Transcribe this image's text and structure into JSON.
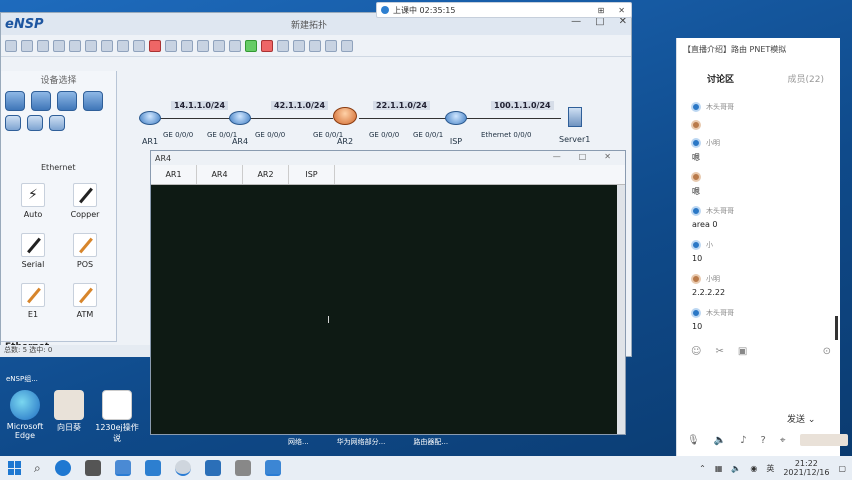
{
  "ensp": {
    "logo": "eNSP",
    "title": "新建拓扑",
    "controls": [
      "—",
      "□",
      "✕"
    ],
    "device_panel_title": "设备选择",
    "ethernet_label": "Ethernet",
    "cables": [
      {
        "label": "Auto",
        "style": "bolt"
      },
      {
        "label": "Copper",
        "style": "black"
      },
      {
        "label": "Serial",
        "style": "black"
      },
      {
        "label": "POS",
        "style": "orange"
      },
      {
        "label": "E1",
        "style": "orange"
      },
      {
        "label": "ATM",
        "style": "black"
      }
    ],
    "section_label": "Ethernet",
    "status": "总数: 5  选中: 0"
  },
  "topology": {
    "subnets": [
      "14.1.1.0/24",
      "42.1.1.0/24",
      "22.1.1.0/24",
      "100.1.1.0/24"
    ],
    "nodes": [
      "AR1",
      "AR4",
      "AR2",
      "ISP",
      "Server1"
    ],
    "ports": [
      "GE 0/0/0",
      "GE 0/0/1",
      "GE 0/0/0",
      "GE 0/0/1",
      "GE 0/0/0",
      "GE 0/0/1",
      "Ethernet 0/0/0"
    ]
  },
  "console": {
    "title": "AR4",
    "controls": [
      "—",
      "□",
      "✕"
    ],
    "tabs": [
      "AR1",
      "AR4",
      "AR2",
      "ISP"
    ]
  },
  "recording": {
    "text": "上课中 02:35:15",
    "controls": [
      "⊞",
      "✕"
    ]
  },
  "chat": {
    "header": "【直播介绍】路由  PNET模拟",
    "tabs": {
      "active": "讨论区",
      "inactive": "成员(22)"
    },
    "messages": [
      {
        "name": "木头哥哥",
        "text": "",
        "avatar": "blue"
      },
      {
        "name": "",
        "text": "",
        "avatar": "brown"
      },
      {
        "name": "小明",
        "text": "嗯",
        "avatar": "blue"
      },
      {
        "name": "",
        "text": "嗯",
        "avatar": "brown"
      },
      {
        "name": "木头哥哥",
        "text": "area 0",
        "avatar": "blue"
      },
      {
        "name": "小",
        "text": "10",
        "avatar": "blue"
      },
      {
        "name": "小明",
        "text": "2.2.2.22",
        "avatar": "brown"
      },
      {
        "name": "木头哥哥",
        "text": "10",
        "avatar": "blue"
      }
    ],
    "send_label": "发送",
    "send_arrow": "⌄"
  },
  "desktop": {
    "taskbar_label_top": "eNSP组...",
    "icons": [
      {
        "label": "Microsoft Edge",
        "kind": "edge"
      },
      {
        "label": "向日葵",
        "kind": "app"
      },
      {
        "label": "1230ej操作说",
        "kind": "doc"
      }
    ],
    "strip": [
      "网络...",
      "华为网络部分...",
      "路由器配..."
    ]
  },
  "taskbar": {
    "ime": "英",
    "time": "21:22",
    "date": "2021/12/16"
  }
}
